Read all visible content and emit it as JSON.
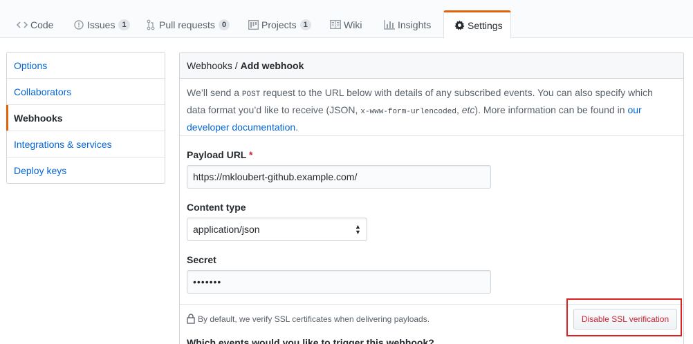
{
  "tabs": [
    {
      "label": "Code",
      "icon": "code-icon"
    },
    {
      "label": "Issues",
      "count": "1",
      "icon": "issue-icon"
    },
    {
      "label": "Pull requests",
      "count": "0",
      "icon": "pull-request-icon"
    },
    {
      "label": "Projects",
      "count": "1",
      "icon": "project-icon"
    },
    {
      "label": "Wiki",
      "icon": "book-icon"
    },
    {
      "label": "Insights",
      "icon": "graph-icon"
    },
    {
      "label": "Settings",
      "icon": "gear-icon",
      "selected": true
    }
  ],
  "sidebar": {
    "items": [
      {
        "label": "Options"
      },
      {
        "label": "Collaborators"
      },
      {
        "label": "Webhooks",
        "selected": true
      },
      {
        "label": "Integrations & services"
      },
      {
        "label": "Deploy keys"
      }
    ]
  },
  "header": {
    "crumb": "Webhooks",
    "separator": " / ",
    "title": "Add webhook"
  },
  "intro": {
    "t1": "We’ll send a ",
    "code1": "POST",
    "t2": " request to the URL below with details of any subscribed events. You can also specify which data format you’d like to receive (JSON, ",
    "code2": "x-www-form-urlencoded",
    "t3": ", ",
    "etc": "etc",
    "t4": "). More information can be found in ",
    "link": "our developer documentation",
    "t5": "."
  },
  "form": {
    "payload_label": "Payload URL",
    "required_mark": "*",
    "payload_value": "https://mkloubert-github.example.com/",
    "content_type_label": "Content type",
    "content_type_value": "application/json",
    "secret_label": "Secret",
    "secret_value": "•••••••"
  },
  "ssl": {
    "note": "By default, we verify SSL certificates when delivering payloads.",
    "button": "Disable SSL verification"
  },
  "events": {
    "question": "Which events would you like to trigger this webhook?"
  },
  "colors": {
    "accent": "#e36209",
    "link": "#0366d6",
    "danger": "#cb2431",
    "highlight": "#e02020"
  }
}
